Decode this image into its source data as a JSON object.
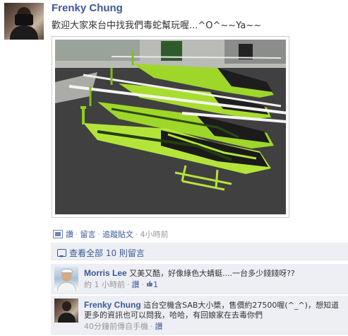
{
  "post": {
    "author": "Frenky Chung",
    "message": "歡迎大家來台中找我們毒蛇幫玩喔...^O^~~Ya~~",
    "photo_icon": "helicopter-photo",
    "actions": {
      "like": "讚",
      "comment": "留言",
      "follow": "追蹤貼文",
      "sep": "·",
      "time": "4小時前"
    }
  },
  "comments": {
    "view_all": "查看全部 10 則留言",
    "items": [
      {
        "name": "Morris Lee",
        "text": "又美又酷，好像綠色大蜻蜓....一台多少錢錢呀??",
        "time": "約 1 小時前",
        "like": "讚",
        "like_count": "1",
        "thumb_icon": "thumbs-up-icon"
      },
      {
        "name": "Frenky Chung",
        "text": "這台空機含SAB大小槳，售價約27500喔(^_^)，想知道更多的資訊也可以問我，哈哈，有回娘家在去毒你們",
        "time": "40分鐘前傳自手機",
        "like": "讚"
      }
    ]
  },
  "colors": {
    "link": "#3b5998",
    "comment_bg": "#edeff4",
    "heli_green": "#9fd62a"
  }
}
